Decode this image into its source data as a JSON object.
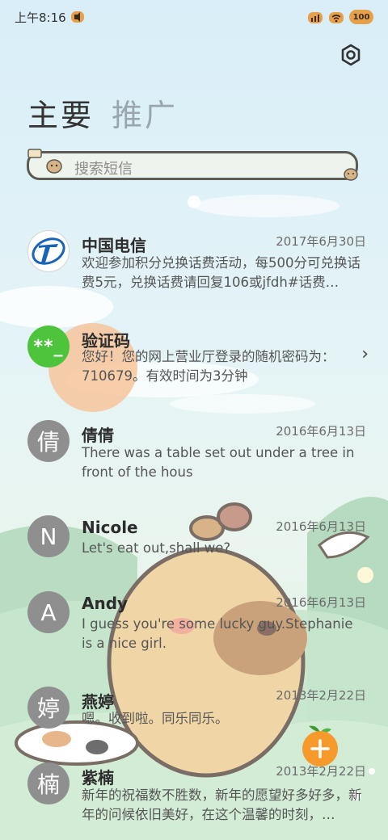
{
  "status_bar": {
    "time": "上午8:16",
    "battery": "100"
  },
  "tabs": {
    "main": "主要",
    "promo": "推广"
  },
  "search": {
    "placeholder": "搜索短信"
  },
  "messages": [
    {
      "sender": "中国电信",
      "date": "2017年6月30日",
      "preview": "欢迎参加积分兑换话费活动，每500分可兑换话费5元，兑换话费请回复106或jfdh#话费…",
      "avatar": "telecom-logo-icon"
    },
    {
      "sender": "验证码",
      "date": "",
      "preview": "您好！您的网上营业厅登录的随机密码为：710679。有效时间为3分钟",
      "avatar_text": "**_"
    },
    {
      "sender": "倩倩",
      "date": "2016年6月13日",
      "preview": "There was a table set out under a tree in front of the hous",
      "avatar_text": "倩"
    },
    {
      "sender": "Nicole",
      "date": "2016年6月13日",
      "preview": "Let's eat out,shall we?",
      "avatar_text": "N"
    },
    {
      "sender": "Andy",
      "date": "2016年6月13日",
      "preview": "I guess you're some lucky guy.Stephanie is a nice girl.",
      "avatar_text": "A"
    },
    {
      "sender": "燕婷",
      "date": "2013年2月22日",
      "preview": "嗯。收到啦。同乐同乐。",
      "avatar_text": "婷"
    },
    {
      "sender": "紫楠",
      "date": "2013年2月22日",
      "preview": "新年的祝福数不胜数，新年的愿望好多好多，新年的问候依旧美好，在这个温馨的时刻，…",
      "avatar_text": "楠"
    }
  ],
  "colors": {
    "accent_orange": "#f59a2b",
    "otp_green": "#4ec43c",
    "avatar_grey": "#8f8f8f"
  }
}
